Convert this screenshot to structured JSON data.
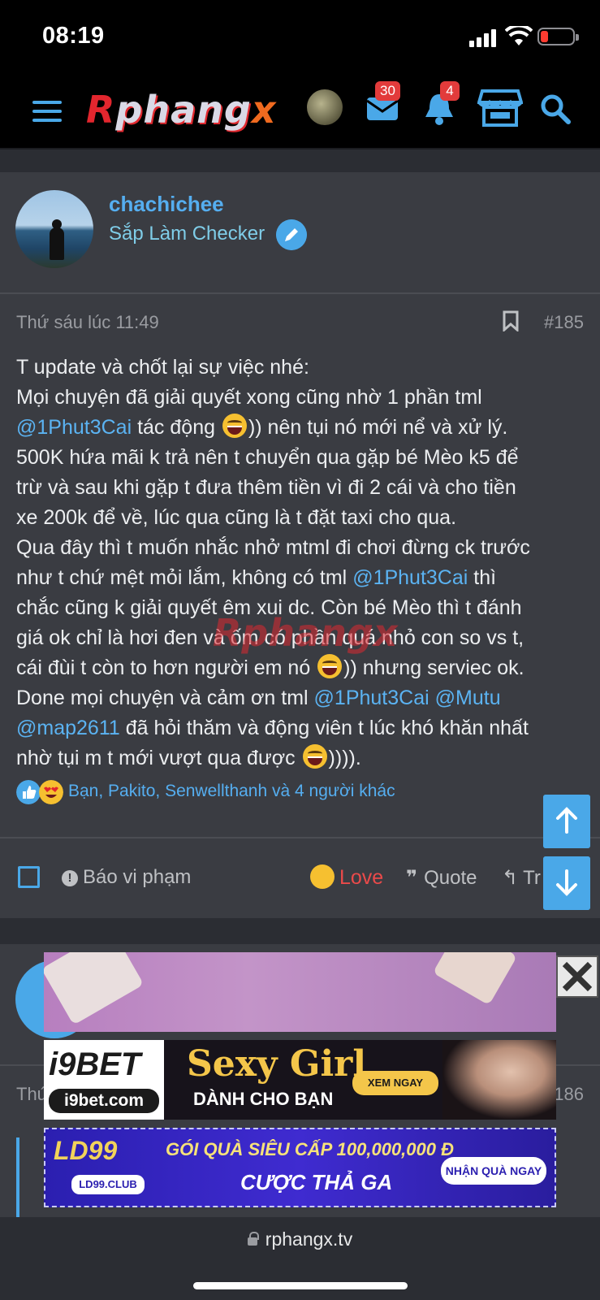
{
  "status": {
    "time": "08:19"
  },
  "header": {
    "logo_text": "Rphangx",
    "messages_count": "30",
    "alerts_count": "4"
  },
  "post": {
    "author": "chachichee",
    "author_title": "Sắp Làm Checker",
    "time": "Thứ sáu lúc 11:49",
    "number": "#185",
    "lines": [
      {
        "t": "T update và chốt lại sự việc nhé:"
      },
      {
        "t": "Mọi chuyện đã giải quyết xong cũng nhờ 1 phần tml"
      },
      {
        "m": "@1Phut3Cai",
        "t": " tác động ",
        "e": true,
        "t2": ")) nên tụi nó mới nể và xử lý."
      },
      {
        "t": "500K hứa mãi k trả nên t chuyển qua gặp bé Mèo k5 để"
      },
      {
        "t": "trừ và sau khi gặp t đưa thêm tiền vì đi 2 cái và cho tiền"
      },
      {
        "t": "xe 200k để về, lúc qua cũng là t đặt taxi cho qua."
      },
      {
        "t": "Qua đây thì t muốn nhắc nhở mtml đi chơi đừng ck trước"
      },
      {
        "t": "như t chứ mệt mỏi lắm, không có tml ",
        "m": "@1Phut3Cai",
        "t2": " thì"
      },
      {
        "t": "chắc cũng k giải quyết êm xui dc. Còn bé Mèo thì t đánh"
      },
      {
        "t": "giá ok chỉ là hơi đen và ốm có phần quá nhỏ con so vs t,"
      },
      {
        "t": "cái đùi t còn to hơn người em nó ",
        "e": true,
        "t2": ")) nhưng serviec ok."
      },
      {
        "t": "Done mọi chuyện và cảm ơn tml ",
        "m": "@1Phut3Cai",
        "t2": " ",
        "m2": "@Mutu"
      },
      {
        "m": "@map2611",
        "t": " đã hỏi thăm và động viên t lúc khó khăn nhất"
      },
      {
        "t": "nhờ tụi m t mới vượt qua được ",
        "e": true,
        "t2": "))))."
      }
    ],
    "reactions_text": "Bạn, Pakito, Senwellthanh và 4 người khác",
    "actions": {
      "report": "Báo vi phạm",
      "love": "Love",
      "quote": "Quote",
      "reply": "Tr"
    }
  },
  "next_post": {
    "time": "Thứ",
    "number": "186"
  },
  "ads": {
    "ad2_brand": "i9BET",
    "ad2_site": "i9bet.com",
    "ad2_headline": "Sexy Girl",
    "ad2_sub": "DÀNH CHO BẠN",
    "ad2_cta": "XEM NGAY",
    "ad3_brand": "LD99",
    "ad3_site": "LD99.CLUB",
    "ad3_headline": "GÓI QUÀ SIÊU CẤP 100,000,000 Đ",
    "ad3_sub": "CƯỢC THẢ GA",
    "ad3_cta": "NHẬN QUÀ NGAY"
  },
  "browser": {
    "url": "rphangx.tv"
  },
  "colors": {
    "accent": "#4aa8e8",
    "love": "#ea4a4a",
    "badge": "#e23b3b"
  }
}
